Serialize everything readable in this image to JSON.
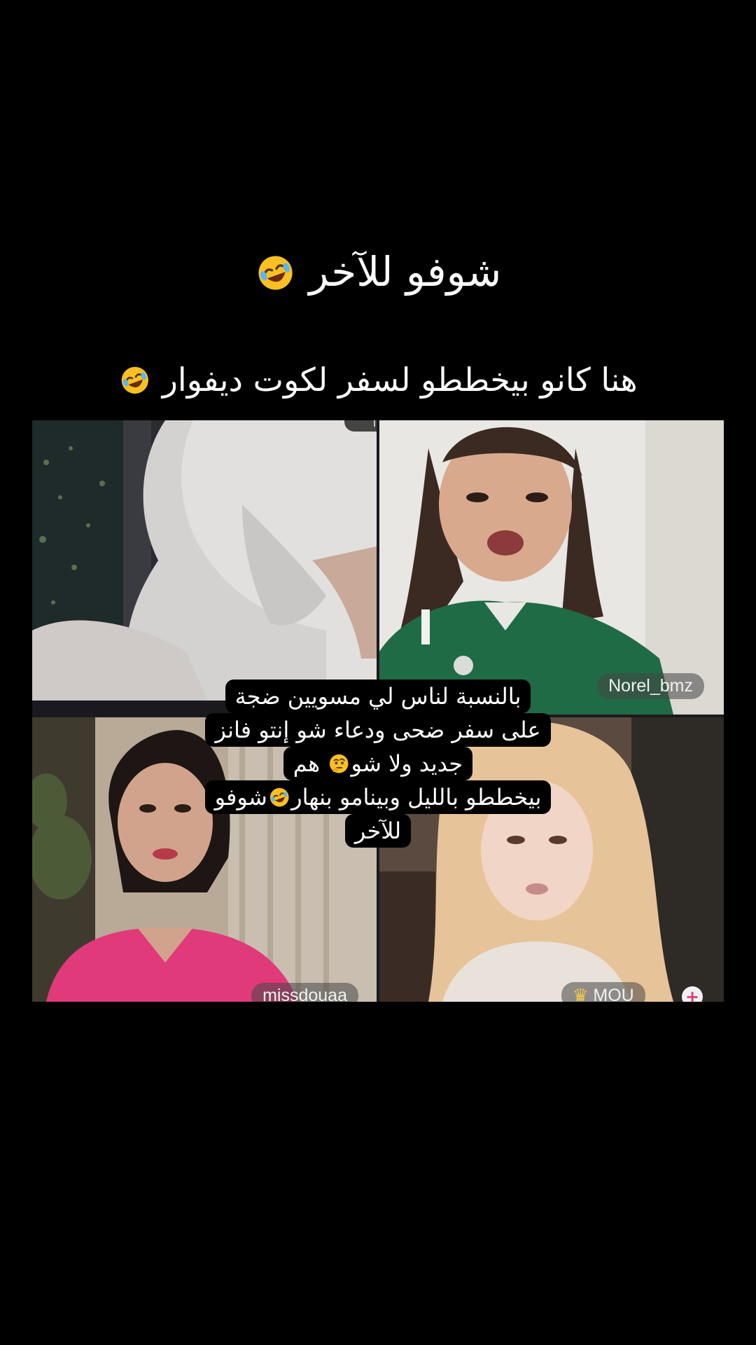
{
  "headline": {
    "text": "شوفو للآخر",
    "emoji": "rolling-laughing-emoji"
  },
  "subhead": {
    "text": "هنا كانو بيخططو لسفر لكوت ديفوار",
    "emoji": "rolling-laughing-emoji"
  },
  "video_grid": {
    "participants": [
      {
        "name": "",
        "scene": "hijab-side-profile"
      },
      {
        "name": "Norel_bmz",
        "scene": "green-jersey"
      },
      {
        "name": "missdouaa",
        "scene": "pink-top"
      },
      {
        "name": "MOU",
        "scene": "blonde-hair",
        "badge": "crown-icon"
      }
    ],
    "handle_text": "ııı"
  },
  "caption": {
    "lines": [
      "بالنسبة لناس لي مسويين ضجة",
      "على سفر ضحى ودعاء شو إنتو فانز",
      "جديد ولا شو",
      "بيخططو بالليل وبينامو بنهار",
      "للآخر"
    ],
    "line3_suffix": "هم",
    "line4_suffix": "شوفو"
  },
  "colors": {
    "background": "#000000",
    "text": "#ffffff",
    "caption_bg": "#000000"
  }
}
